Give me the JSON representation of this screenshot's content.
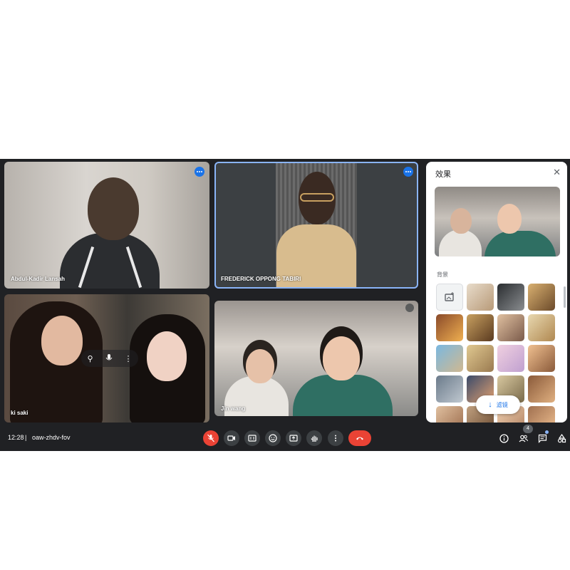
{
  "participants": [
    {
      "name": "Abdul-Kadir Lansah"
    },
    {
      "name": "FREDERICK OPPONG TABIRI"
    },
    {
      "name": "ki saki"
    },
    {
      "name": "Jin wang"
    }
  ],
  "effects_panel": {
    "title": "效果",
    "section_label": "背景",
    "filter_button": "滤镜"
  },
  "bottom_bar": {
    "time": "12:28",
    "separator": "|",
    "meeting_code": "oaw-zhdv-fov",
    "participant_count": "4"
  },
  "colors": {
    "end_call": "#ea4335",
    "mic_off": "#ea4335",
    "accent": "#1a73e8",
    "bar_bg": "#202124"
  },
  "icons": [
    "more-options-icon",
    "pin-icon",
    "mic-icon",
    "close-icon",
    "add-photo-icon",
    "download-arrow-icon",
    "mic-off-icon",
    "camera-icon",
    "captions-icon",
    "emoji-icon",
    "present-icon",
    "raise-hand-icon",
    "more-vert-icon",
    "end-call-icon",
    "info-icon",
    "people-icon",
    "chat-icon",
    "activities-icon"
  ]
}
